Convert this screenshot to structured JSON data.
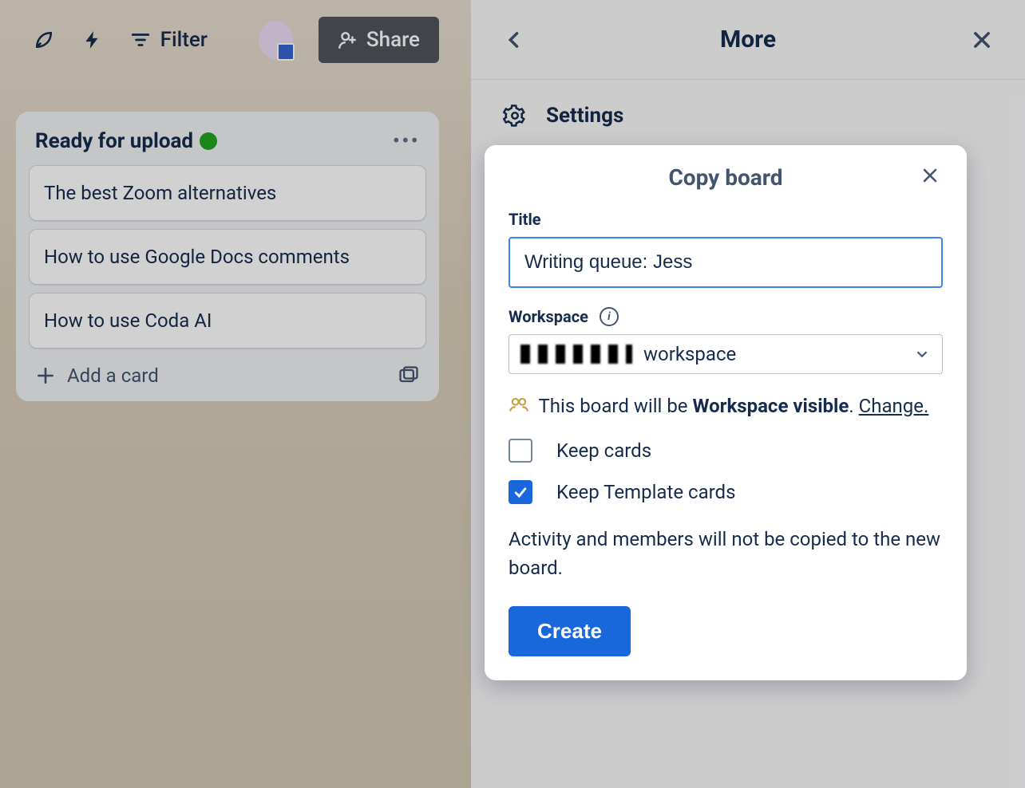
{
  "toolbar": {
    "filter_label": "Filter",
    "share_label": "Share"
  },
  "list": {
    "title": "Ready for upload",
    "cards": [
      "The best Zoom alternatives",
      "How to use Google Docs comments",
      "How to use Coda AI"
    ],
    "add_card_label": "Add a card"
  },
  "panel": {
    "title": "More",
    "settings_label": "Settings"
  },
  "modal": {
    "title": "Copy board",
    "title_field_label": "Title",
    "title_value": "Writing queue: Jess",
    "workspace_label": "Workspace",
    "workspace_value": "workspace",
    "visibility_prefix": "This board will be ",
    "visibility_level": "Workspace visible",
    "change_label": "Change.",
    "keep_cards_label": "Keep cards",
    "keep_cards_checked": false,
    "keep_template_label": "Keep Template cards",
    "keep_template_checked": true,
    "hint": "Activity and members will not be copied to the new board.",
    "create_label": "Create"
  }
}
